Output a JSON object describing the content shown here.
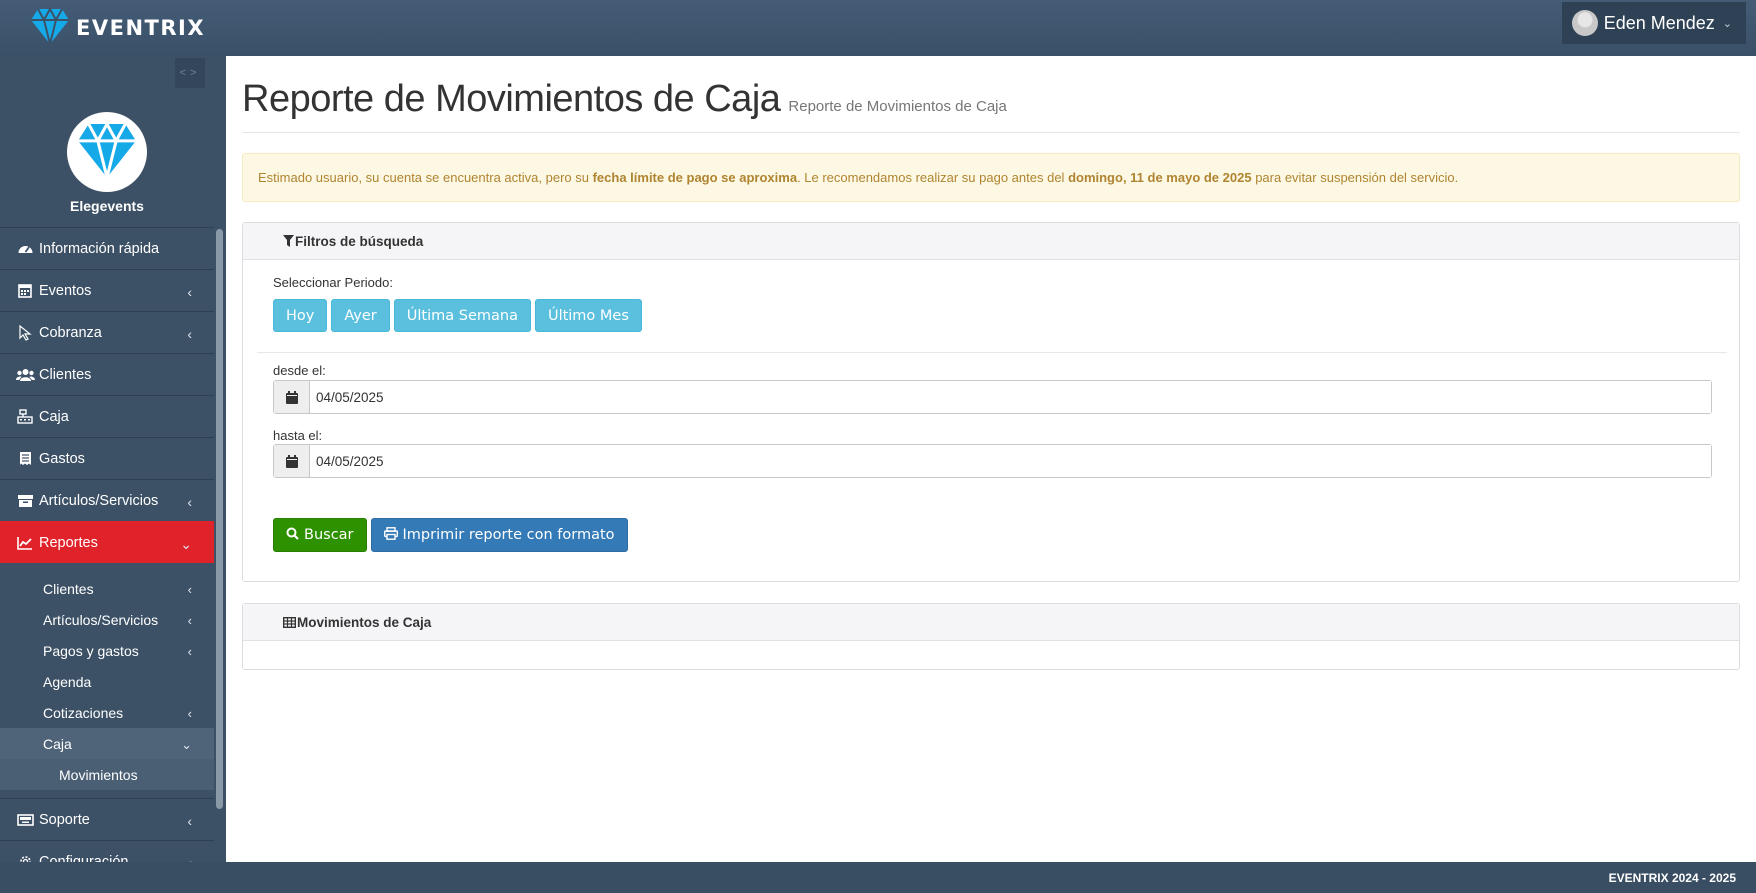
{
  "app": {
    "brand_name": "EVENTRIX",
    "brand_color": "#16a9e8",
    "user_name": "Eden Mendez"
  },
  "sidebar": {
    "profile_name": "Elegevents",
    "items": [
      {
        "label": "Información rápida",
        "icon": "dashboard-icon"
      },
      {
        "label": "Eventos",
        "icon": "calendar-icon"
      },
      {
        "label": "Cobranza",
        "icon": "cursor-icon"
      },
      {
        "label": "Clientes",
        "icon": "users-icon"
      },
      {
        "label": "Caja",
        "icon": "cash-register-icon"
      },
      {
        "label": "Gastos",
        "icon": "receipt-icon"
      },
      {
        "label": "Artículos/Servicios",
        "icon": "box-icon"
      },
      {
        "label": "Reportes",
        "icon": "chart-icon"
      }
    ],
    "sub_items": [
      {
        "label": "Clientes"
      },
      {
        "label": "Artículos/Servicios"
      },
      {
        "label": "Pagos y gastos"
      },
      {
        "label": "Agenda"
      },
      {
        "label": "Cotizaciones"
      },
      {
        "label": "Caja"
      }
    ],
    "sub_sub_items": [
      {
        "label": "Movimientos"
      }
    ],
    "after_items": [
      {
        "label": "Soporte",
        "icon": "keyboard-icon"
      },
      {
        "label": "Configuración",
        "icon": "gear-icon"
      }
    ]
  },
  "page": {
    "title": "Reporte de Movimientos de Caja",
    "subtitle": "Reporte de Movimientos de Caja"
  },
  "alert": {
    "text_1": "Estimado usuario, su cuenta se encuentra activa, pero su ",
    "bold_1": "fecha límite de pago se aproxima",
    "text_2": ". Le recomendamos realizar su pago antes del ",
    "bold_2": "domingo, 11 de mayo de 2025",
    "text_3": " para evitar suspensión del servicio."
  },
  "filters": {
    "title": "Filtros de búsqueda",
    "period_label": "Seleccionar Periodo:",
    "period_buttons": [
      "Hoy",
      "Ayer",
      "Última Semana",
      "Último Mes"
    ],
    "from_label": "desde el:",
    "from_value": "04/05/2025",
    "to_label": "hasta el:",
    "to_value": "04/05/2025",
    "search_label": "Buscar",
    "print_label": "Imprimir reporte con formato"
  },
  "movements": {
    "title": "Movimientos de Caja"
  },
  "footer": {
    "text": "EVENTRIX 2024 - 2025"
  },
  "colors": {
    "active_menu": "#e0232a",
    "period_button": "#5bc0de",
    "search_button": "#2e9200",
    "print_button": "#337ab7",
    "alert_bg": "#fcf8e3"
  }
}
